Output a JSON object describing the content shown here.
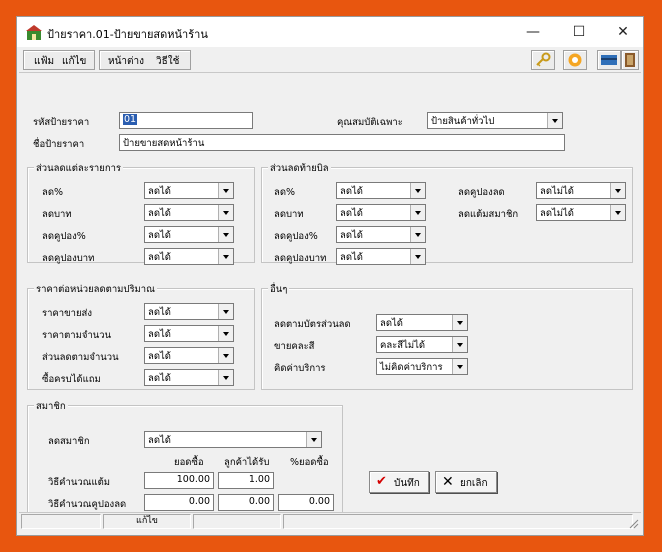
{
  "window": {
    "title": "ป้ายราคา.01-ป้ายขายสดหน้าร้าน",
    "minimize": "—",
    "maximize": "☐",
    "close": "✕"
  },
  "menu": {
    "file": "แฟ้ม",
    "edit": "แก้ไข",
    "window": "หน้าต่าง",
    "help": "วิธีใช้"
  },
  "header": {
    "code_label": "รหัสป้ายราคา",
    "code_value": "01",
    "name_label": "ชื่อป้ายราคา",
    "name_value": "ป้ายขายสดหน้าร้าน",
    "property_label": "คุณสมบัติเฉพาะ",
    "property_value": "ป้ายสินค้าทั่วไป"
  },
  "item_discount": {
    "title": "ส่วนลดแต่ละรายการ",
    "rows": [
      {
        "label": "ลด%",
        "value": "ลดได้"
      },
      {
        "label": "ลดบาท",
        "value": "ลดได้"
      },
      {
        "label": "ลดคูปอง%",
        "value": "ลดได้"
      },
      {
        "label": "ลดคูปองบาท",
        "value": "ลดได้"
      }
    ]
  },
  "bill_discount": {
    "title": "ส่วนลดท้ายบิล",
    "rows": [
      {
        "label": "ลด%",
        "value": "ลดได้"
      },
      {
        "label": "ลดบาท",
        "value": "ลดได้"
      },
      {
        "label": "ลดคูปอง%",
        "value": "ลดได้"
      },
      {
        "label": "ลดคูปองบาท",
        "value": "ลดได้"
      }
    ],
    "right_rows": [
      {
        "label": "ลดคูปองลด",
        "value": "ลดไม่ได้"
      },
      {
        "label": "ลดแต้มสมาชิก",
        "value": "ลดไม่ได้"
      }
    ]
  },
  "qty_price": {
    "title": "ราคาต่อหน่วยลดตามปริมาณ",
    "rows": [
      {
        "label": "ราคาขายส่ง",
        "value": "ลดได้"
      },
      {
        "label": "ราคาตามจำนวน",
        "value": "ลดได้"
      },
      {
        "label": "ส่วนลดตามจำนวน",
        "value": "ลดได้"
      },
      {
        "label": "ซื้อครบได้แถม",
        "value": "ลดได้"
      }
    ]
  },
  "other": {
    "title": "อื่นๆ",
    "rows": [
      {
        "label": "ลดตามบัตรส่วนลด",
        "value": "ลดได้"
      },
      {
        "label": "ขายคละสี",
        "value": "คละสีไม่ได้"
      },
      {
        "label": "คิดค่าบริการ",
        "value": "ไม่คิดค่าบริการ"
      }
    ]
  },
  "member": {
    "title": "สมาชิก",
    "discount_label": "ลดสมาชิก",
    "discount_value": "ลดได้",
    "col_buy": "ยอดซื้อ",
    "col_get": "ลูกค้าได้รับ",
    "col_pct": "%ยอดซื้อ",
    "points_label": "วิธีคำนวณแต้ม",
    "points_buy": "100.00",
    "points_get": "1.00",
    "coupon_label": "วิธีคำนวณคูปองลด",
    "coupon_buy": "0.00",
    "coupon_get": "0.00",
    "coupon_pct": "0.00"
  },
  "buttons": {
    "save": "บันทึก",
    "cancel": "ยกเลิก"
  },
  "status": {
    "mode": "แก้ไข"
  },
  "colors": {
    "background": "#e8560f",
    "selection": "#2a5db0",
    "save_check": "#d40000"
  }
}
